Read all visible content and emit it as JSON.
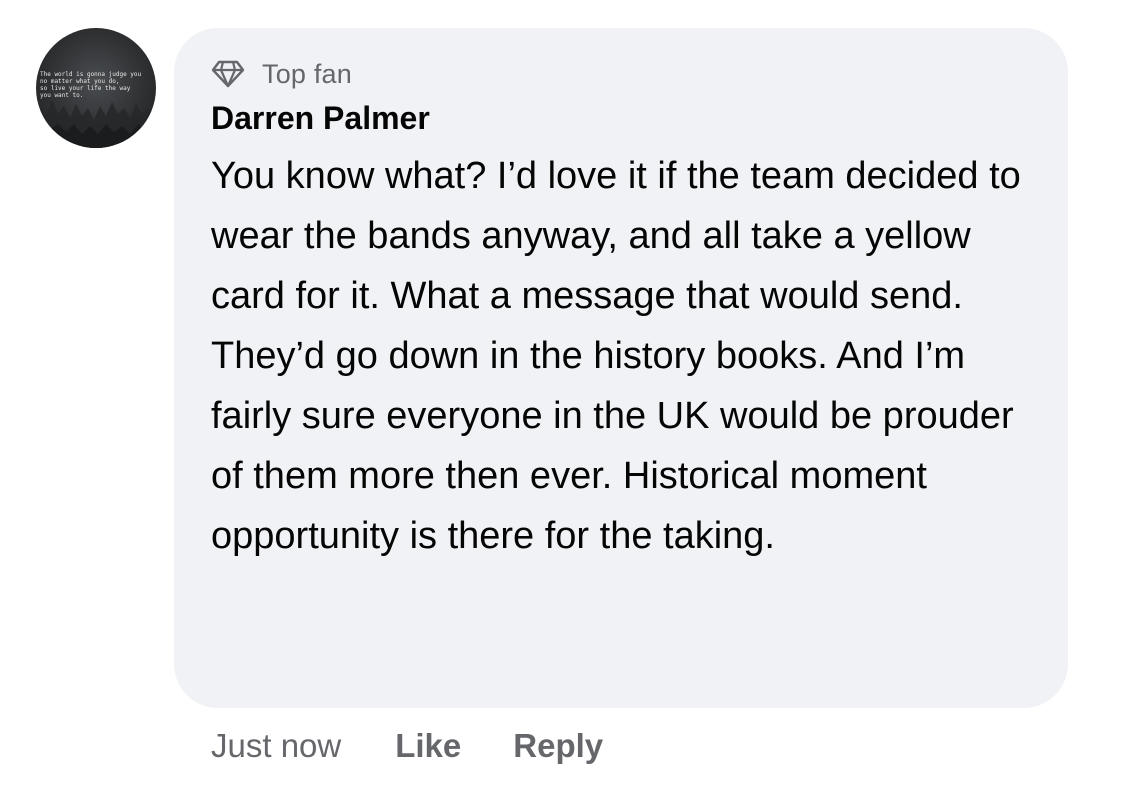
{
  "avatar": {
    "icon": "profile-photo",
    "quote": "The world is gonna judge you\nno matter what you do,\nso live your life the way\nyou want to."
  },
  "comment": {
    "badge_icon": "diamond-icon",
    "badge": "Top fan",
    "author": "Darren Palmer",
    "text": "You know what? I’d love it if the team decided to wear the bands anyway, and all take a yellow card for it. What a message that would send. They’d go down in the history books. And I’m fairly sure everyone in the UK would be prouder of them more then ever. Historical moment opportunity is there for the taking."
  },
  "actions": {
    "timestamp": "Just now",
    "like": "Like",
    "reply": "Reply"
  },
  "colors": {
    "bubble": "#f0f2f5",
    "secondary_text": "#65676b",
    "primary_text": "#050505"
  }
}
